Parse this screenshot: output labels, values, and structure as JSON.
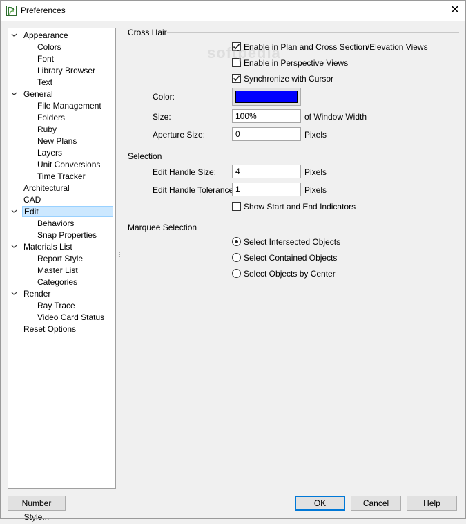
{
  "window": {
    "title": "Preferences",
    "close_glyph": "✕"
  },
  "tree": {
    "items": [
      {
        "label": "Appearance",
        "level": 0,
        "expanded": true
      },
      {
        "label": "Colors",
        "level": 1
      },
      {
        "label": "Font",
        "level": 1
      },
      {
        "label": "Library Browser",
        "level": 1
      },
      {
        "label": "Text",
        "level": 1
      },
      {
        "label": "General",
        "level": 0,
        "expanded": true
      },
      {
        "label": "File Management",
        "level": 1
      },
      {
        "label": "Folders",
        "level": 1
      },
      {
        "label": "Ruby",
        "level": 1
      },
      {
        "label": "New Plans",
        "level": 1
      },
      {
        "label": "Layers",
        "level": 1
      },
      {
        "label": "Unit Conversions",
        "level": 1
      },
      {
        "label": "Time Tracker",
        "level": 1
      },
      {
        "label": "Architectural",
        "level": 0
      },
      {
        "label": "CAD",
        "level": 0
      },
      {
        "label": "Edit",
        "level": 0,
        "expanded": true,
        "selected": true
      },
      {
        "label": "Behaviors",
        "level": 1
      },
      {
        "label": "Snap Properties",
        "level": 1
      },
      {
        "label": "Materials List",
        "level": 0,
        "expanded": true
      },
      {
        "label": "Report Style",
        "level": 1
      },
      {
        "label": "Master List",
        "level": 1
      },
      {
        "label": "Categories",
        "level": 1
      },
      {
        "label": "Render",
        "level": 0,
        "expanded": true
      },
      {
        "label": "Ray Trace",
        "level": 1
      },
      {
        "label": "Video Card Status",
        "level": 1
      },
      {
        "label": "Reset Options",
        "level": 0
      }
    ]
  },
  "crosshair": {
    "group_label": "Cross Hair",
    "enable_plan": {
      "label": "Enable in Plan and Cross Section/Elevation Views",
      "checked": true
    },
    "enable_perspective": {
      "label": "Enable in Perspective Views",
      "checked": false
    },
    "sync_cursor": {
      "label": "Synchronize with Cursor",
      "checked": true
    },
    "color_label": "Color:",
    "color_value": "#0000ff",
    "size_label": "Size:",
    "size_value": "100%",
    "size_unit": "of Window Width",
    "aperture_label": "Aperture Size:",
    "aperture_value": "0",
    "aperture_unit": "Pixels"
  },
  "selection": {
    "group_label": "Selection",
    "handle_size_label": "Edit Handle Size:",
    "handle_size_value": "4",
    "handle_size_unit": "Pixels",
    "handle_tol_label": "Edit Handle Tolerance:",
    "handle_tol_value": "1",
    "handle_tol_unit": "Pixels",
    "show_indicators": {
      "label": "Show Start and End Indicators",
      "checked": false
    }
  },
  "marquee": {
    "group_label": "Marquee Selection",
    "options": [
      {
        "label": "Select Intersected Objects",
        "selected": true
      },
      {
        "label": "Select Contained Objects",
        "selected": false
      },
      {
        "label": "Select Objects by Center",
        "selected": false
      }
    ]
  },
  "buttons": {
    "number_style": "Number Style...",
    "ok": "OK",
    "cancel": "Cancel",
    "help": "Help"
  },
  "watermark": "softpedia"
}
